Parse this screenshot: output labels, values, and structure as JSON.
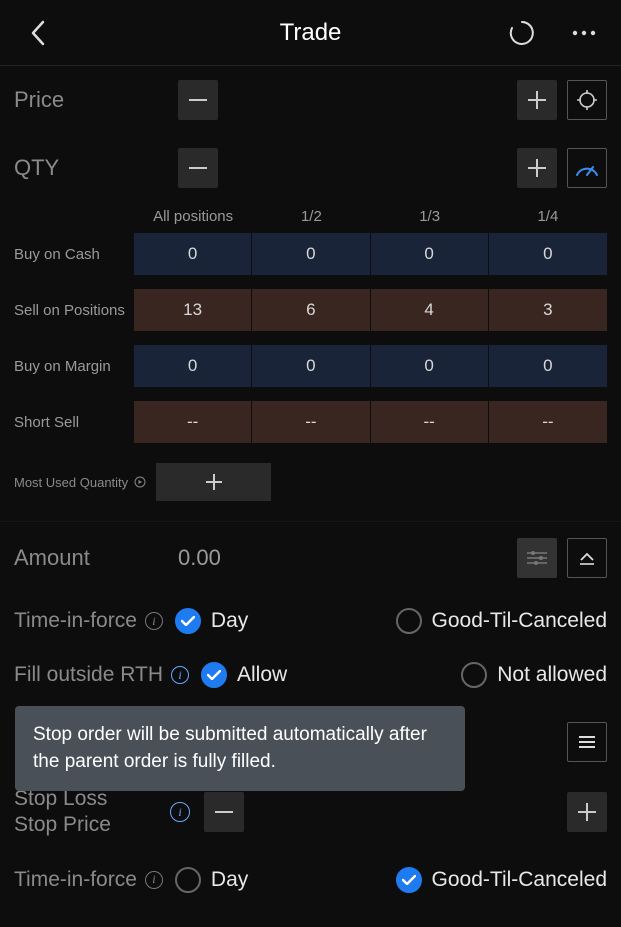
{
  "header": {
    "title": "Trade"
  },
  "price": {
    "label": "Price"
  },
  "qty": {
    "label": "QTY"
  },
  "qty_table": {
    "headers": [
      "All positions",
      "1/2",
      "1/3",
      "1/4"
    ],
    "rows": [
      {
        "label": "Buy on Cash",
        "kind": "buy",
        "cells": [
          "0",
          "0",
          "0",
          "0"
        ]
      },
      {
        "label": "Sell on Positions",
        "kind": "sell",
        "cells": [
          "13",
          "6",
          "4",
          "3"
        ]
      },
      {
        "label": "Buy on Margin",
        "kind": "buy",
        "cells": [
          "0",
          "0",
          "0",
          "0"
        ]
      },
      {
        "label": "Short Sell",
        "kind": "sell",
        "cells": [
          "--",
          "--",
          "--",
          "--"
        ]
      }
    ]
  },
  "most_used": {
    "label": "Most Used Quantity"
  },
  "amount": {
    "label": "Amount",
    "value": "0.00"
  },
  "tif": {
    "label": "Time-in-force",
    "options": [
      {
        "label": "Day",
        "checked": true
      },
      {
        "label": "Good-Til-Canceled",
        "checked": false
      }
    ]
  },
  "fill_outside": {
    "label": "Fill outside RTH",
    "options": [
      {
        "label": "Allow",
        "checked": true
      },
      {
        "label": "Not allowed",
        "checked": false
      }
    ]
  },
  "tooltip": {
    "text": "Stop order will be submitted automatically after the parent order is fully filled."
  },
  "stop_loss": {
    "line1": "Stop Loss",
    "line2": "Stop Price"
  },
  "tif2": {
    "label": "Time-in-force",
    "options": [
      {
        "label": "Day",
        "checked": false
      },
      {
        "label": "Good-Til-Canceled",
        "checked": true
      }
    ]
  }
}
